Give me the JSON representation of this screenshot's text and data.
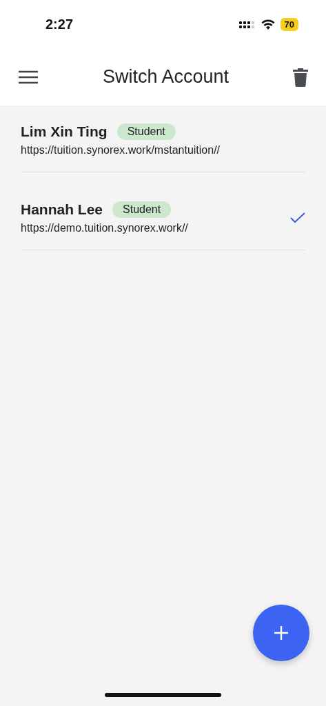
{
  "status_bar": {
    "time": "2:27",
    "battery": "70"
  },
  "header": {
    "title": "Switch Account"
  },
  "accounts": [
    {
      "name": "Lim Xin Ting",
      "role": "Student",
      "url": "https://tuition.synorex.work/mstantuition//",
      "selected": false
    },
    {
      "name": "Hannah Lee",
      "role": "Student",
      "url": "https://demo.tuition.synorex.work//",
      "selected": true
    }
  ]
}
